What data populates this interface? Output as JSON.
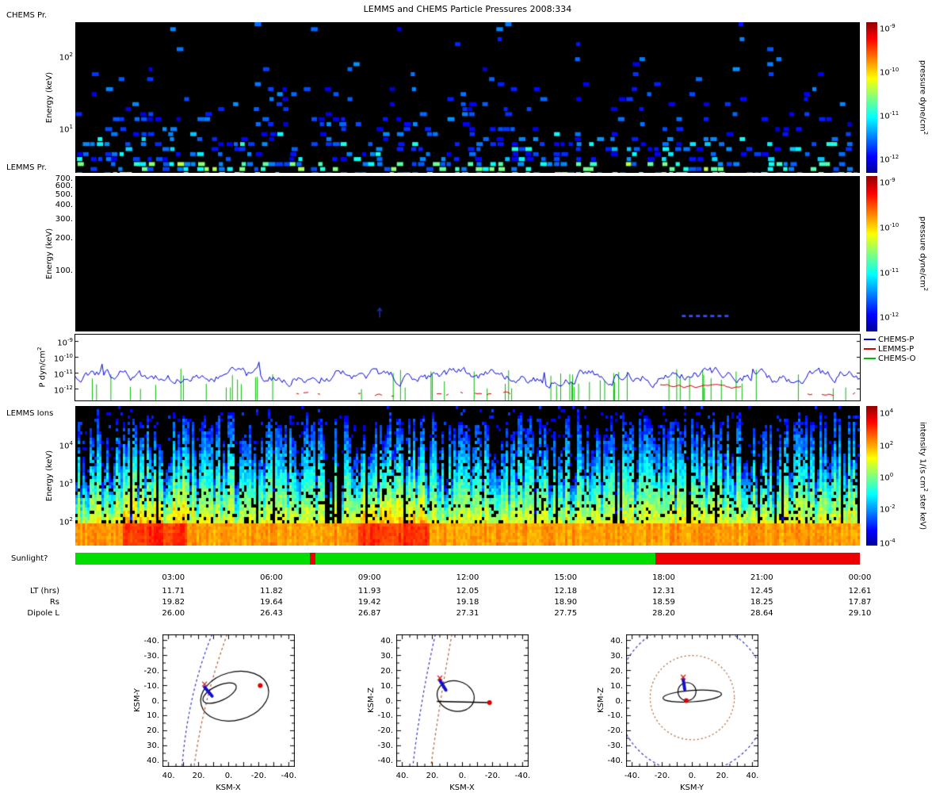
{
  "title": "LEMMS and CHEMS Particle Pressures  2008:334",
  "panel_chems": {
    "label": "CHEMS Pr.",
    "ylabel": "Energy (keV)",
    "yticks": [
      {
        "t": "10^2",
        "f": 0.22
      },
      {
        "t": "10^1",
        "f": 0.7
      }
    ],
    "colorbar": {
      "label": "pressure dyne/cm^2",
      "ticks": [
        {
          "t": "10^-9",
          "f": 0.03
        },
        {
          "t": "10^-10",
          "f": 0.32
        },
        {
          "t": "10^-11",
          "f": 0.61
        },
        {
          "t": "10^-12",
          "f": 0.9
        }
      ]
    }
  },
  "panel_lemms": {
    "label": "LEMMS Pr.",
    "ylabel": "Energy (keV)",
    "yticks": [
      {
        "t": "700.",
        "f": 0.021
      },
      {
        "t": "600.",
        "f": 0.068
      },
      {
        "t": "500.",
        "f": 0.123
      },
      {
        "t": "400.",
        "f": 0.191
      },
      {
        "t": "300.",
        "f": 0.279
      },
      {
        "t": "200.",
        "f": 0.402
      },
      {
        "t": "100.",
        "f": 0.613
      }
    ],
    "features": {
      "dash": {
        "x0": 0.773,
        "x1": 0.833,
        "yf": 0.9
      },
      "arrow": {
        "x": 0.388,
        "yf": 0.85
      }
    },
    "colorbar": {
      "label": "pressure dyne/cm^2",
      "ticks": [
        {
          "t": "10^-9",
          "f": 0.03
        },
        {
          "t": "10^-10",
          "f": 0.32
        },
        {
          "t": "10^-11",
          "f": 0.61
        },
        {
          "t": "10^-12",
          "f": 0.9
        }
      ]
    }
  },
  "panel_pressure": {
    "ylabel": "P dyn/cm^2",
    "yticks": [
      {
        "t": "10^-9",
        "f": 0.1
      },
      {
        "t": "10^-10",
        "f": 0.34
      },
      {
        "t": "10^-11",
        "f": 0.58
      },
      {
        "t": "10^-12",
        "f": 0.82
      }
    ],
    "legend": [
      {
        "label": "CHEMS-P",
        "color": "#0000dd"
      },
      {
        "label": "LEMMS-P",
        "color": "#dd0000"
      },
      {
        "label": "CHEMS-O",
        "color": "#00bb00"
      }
    ]
  },
  "panel_ions": {
    "label": "LEMMS Ions",
    "ylabel": "Energy (keV)",
    "yticks": [
      {
        "t": "10^4",
        "f": 0.27
      },
      {
        "t": "10^3",
        "f": 0.545
      },
      {
        "t": "10^2",
        "f": 0.82
      }
    ],
    "orange_zones": [
      [
        0.06,
        0.14
      ],
      [
        0.36,
        0.45
      ]
    ],
    "colorbar": {
      "label": "intensity 1/(s cm^2 ster keV)",
      "ticks": [
        {
          "t": "10^4",
          "f": 0.04
        },
        {
          "t": "10^2",
          "f": 0.27
        },
        {
          "t": "10^0",
          "f": 0.5
        },
        {
          "t": "10^-2",
          "f": 0.73
        },
        {
          "t": "10^-4",
          "f": 0.97
        }
      ]
    }
  },
  "sunlight": {
    "label": "Sunlight?",
    "segments": [
      {
        "color": "#00dd00",
        "f0": 0.0,
        "f1": 0.739
      },
      {
        "color": "#ee0000",
        "f0": 0.299,
        "f1": 0.306
      },
      {
        "color": "#ee0000",
        "f0": 0.739,
        "f1": 1.0
      }
    ]
  },
  "time_axis": {
    "ticks": [
      "03:00",
      "06:00",
      "09:00",
      "12:00",
      "15:00",
      "18:00",
      "21:00",
      "00:00"
    ],
    "rows": [
      {
        "label": "LT (hrs)",
        "values": [
          "11.71",
          "11.82",
          "11.93",
          "12.05",
          "12.18",
          "12.31",
          "12.45",
          "12.61"
        ]
      },
      {
        "label": "Rs",
        "values": [
          "19.82",
          "19.64",
          "19.42",
          "19.18",
          "18.90",
          "18.59",
          "18.25",
          "17.87"
        ]
      },
      {
        "label": "Dipole L",
        "values": [
          "26.00",
          "26.43",
          "26.87",
          "27.31",
          "27.75",
          "28.20",
          "28.64",
          "29.10"
        ]
      }
    ]
  },
  "orbit_plots": [
    {
      "xlabel": "KSM-X",
      "ylabel": "KSM-Y",
      "xlim": [
        44,
        -44
      ],
      "ylim": [
        -44,
        44
      ],
      "xtick_labels": [
        "40.",
        "20.",
        "0.",
        "-20.",
        "-40."
      ],
      "ytick_labels": [
        "-40.",
        "-30.",
        "-20.",
        "-10.",
        "0.",
        "10.",
        "20.",
        "30.",
        "40."
      ],
      "curves": [
        {
          "color": "#3333cc",
          "p0": [
            11,
            -44
          ],
          "c": [
            27,
            -5
          ],
          "p1": [
            31,
            44
          ]
        },
        {
          "color": "#b06030",
          "p0": [
            1,
            -44
          ],
          "c": [
            17,
            0
          ],
          "p1": [
            23,
            44
          ]
        }
      ],
      "ellipses": [
        {
          "cx": -4,
          "cy": -3,
          "rx": 23,
          "ry": 16,
          "rot": -15
        },
        {
          "cx": 6,
          "cy": -5,
          "rx": 12,
          "ry": 5,
          "rot": -25
        }
      ],
      "segments": [
        {
          "p0": [
            16,
            -9
          ],
          "p1": [
            11,
            -3
          ],
          "color": "#1111cc",
          "w": 4
        }
      ],
      "markers": [
        {
          "type": "dot",
          "x": -21,
          "y": -10,
          "color": "#dd0000"
        },
        {
          "type": "cross",
          "x": 16,
          "y": -11,
          "color": "#dd2222"
        }
      ]
    },
    {
      "xlabel": "KSM-X",
      "ylabel": "KSM-Z",
      "xlim": [
        44,
        -44
      ],
      "ylim": [
        44,
        -44
      ],
      "xtick_labels": [
        "40.",
        "20.",
        "0.",
        "-20.",
        "-40."
      ],
      "ytick_labels": [
        "40.",
        "30.",
        "20.",
        "10.",
        "0.",
        "-10.",
        "-20.",
        "-30.",
        "-40."
      ],
      "curves": [
        {
          "color": "#3333cc",
          "p0": [
            18,
            44
          ],
          "c": [
            28,
            0
          ],
          "p1": [
            33,
            -44
          ]
        },
        {
          "color": "#b06030",
          "p0": [
            7,
            44
          ],
          "c": [
            15,
            0
          ],
          "p1": [
            21,
            -44
          ]
        }
      ],
      "ellipses": [
        {
          "cx": 4.5,
          "cy": 3,
          "rx": 12.5,
          "ry": 10,
          "rot": 15
        }
      ],
      "lines": [
        {
          "p0": [
            17,
            -0.5
          ],
          "p1": [
            -18,
            -1.3
          ],
          "color": "#000000",
          "w": 1.6
        }
      ],
      "segments": [
        {
          "p0": [
            15,
            13.5
          ],
          "p1": [
            11,
            7
          ],
          "color": "#1111cc",
          "w": 4
        }
      ],
      "markers": [
        {
          "type": "dot",
          "x": -18,
          "y": -1.3,
          "color": "#dd0000"
        },
        {
          "type": "cross",
          "x": 15,
          "y": 15,
          "color": "#dd2222"
        }
      ]
    },
    {
      "xlabel": "KSM-Y",
      "ylabel": "KSM-Z",
      "xlim": [
        -44,
        44
      ],
      "ylim": [
        44,
        -44
      ],
      "xtick_labels": [
        "-40.",
        "-20.",
        "0.",
        "20.",
        "40."
      ],
      "ytick_labels": [
        "40.",
        "30.",
        "20.",
        "10.",
        "0.",
        "-10.",
        "-20.",
        "-30.",
        "-40."
      ],
      "circles": [
        {
          "cx": 0,
          "cy": 2,
          "r": 28,
          "color": "#b06030",
          "dash": [
            2,
            3
          ]
        },
        {
          "cx": 0,
          "cy": 2,
          "r": 50,
          "color": "#3333cc",
          "dash": [
            3,
            3
          ]
        }
      ],
      "ellipses": [
        {
          "cx": 0,
          "cy": 3,
          "rx": 19.5,
          "ry": 3.8,
          "rot": -4
        },
        {
          "cx": -3.5,
          "cy": 6,
          "rx": 6,
          "ry": 6,
          "rot": 0
        }
      ],
      "segments": [
        {
          "p0": [
            -6,
            14
          ],
          "p1": [
            -5,
            7.5
          ],
          "color": "#1111cc",
          "w": 4
        }
      ],
      "markers": [
        {
          "type": "dot",
          "x": -4,
          "y": 0,
          "color": "#dd0000"
        },
        {
          "type": "cross",
          "x": -6,
          "y": 15.5,
          "color": "#dd2222"
        }
      ]
    }
  ],
  "chart_data": [
    {
      "type": "heatmap",
      "title": "CHEMS Pr.",
      "ylabel": "Energy (keV)",
      "yscale": "log",
      "ylim": [
        3,
        250
      ],
      "x_span_hours": [
        0,
        24
      ],
      "zlabel": "pressure dyne/cm^2",
      "zscale": "log",
      "zlim": [
        1e-12,
        1e-09
      ],
      "colormap": "jet",
      "background": "black",
      "pattern": "sparse scattered cells, mostly blue 1e-12..1e-11; density and cyan/green values (~1e-11..3e-11) increase toward the lowest energies"
    },
    {
      "type": "heatmap",
      "title": "LEMMS Pr.",
      "ylabel": "Energy (keV)",
      "yscale": "log",
      "ylim": [
        28,
        750
      ],
      "yticks": [
        100,
        200,
        300,
        400,
        500,
        600,
        700
      ],
      "zlabel": "pressure dyne/cm^2",
      "zscale": "log",
      "zlim": [
        1e-12,
        1e-09
      ],
      "colormap": "jet",
      "background": "black",
      "pattern": "nearly empty; faint blue dashed horizontal segment ~18:30-20:00 near 40 keV; single faint blue mark ~09:20 near 45 keV"
    },
    {
      "type": "line",
      "ylabel": "P dyn/cm^2",
      "yscale": "log",
      "ylim": [
        2e-13,
        2e-09
      ],
      "series": [
        {
          "name": "CHEMS-P",
          "color": "#0000dd",
          "typical_level": 5e-12,
          "range": [
            8e-13,
            4e-11
          ],
          "coverage": "continuous 00:00-24:00"
        },
        {
          "name": "LEMMS-P",
          "color": "#dd0000",
          "typical_level": 2e-13,
          "visible_intervals_hours": [
            [
              6.7,
              14
            ],
            [
              17.9,
              20.4
            ],
            [
              22.3,
              24
            ]
          ],
          "level_in_intervals": 1e-12
        },
        {
          "name": "CHEMS-O",
          "color": "#00bb00",
          "description": "sparse narrow spikes rising from below 1e-12 up to ~1e-11"
        }
      ],
      "legend_position": "right outside"
    },
    {
      "type": "heatmap",
      "title": "LEMMS Ions",
      "ylabel": "Energy (keV)",
      "yscale": "log",
      "ylim": [
        20,
        100000
      ],
      "zlabel": "intensity 1/(s cm^2 ster keV)",
      "zscale": "log",
      "zlim": [
        1e-05,
        10000.0
      ],
      "colormap": "jet",
      "background": "black",
      "pattern": "dense vertical striping across full width; solid yellow-orange band at lowest energies (intensity 10..1000), green-cyan mid energies, sparse blue columns reaching highest energies, intermittent black gaps"
    },
    {
      "type": "bar",
      "title": "Sunlight?",
      "segments": [
        {
          "from_hours": 0,
          "to_hours": 17.73,
          "state": "sunlit",
          "color": "#00dd00"
        },
        {
          "from_hours": 7.17,
          "to_hours": 7.35,
          "state": "shadow",
          "color": "#ee0000"
        },
        {
          "from_hours": 17.73,
          "to_hours": 24,
          "state": "shadow",
          "color": "#ee0000"
        }
      ]
    },
    {
      "type": "scatter",
      "title": "trajectory projections (Rs)",
      "subplots": [
        {
          "xlabel": "KSM-X",
          "ylabel": "KSM-Y",
          "xlim": [
            40,
            -40
          ],
          "ylim": [
            -40,
            40
          ],
          "elements": [
            "black orbit ellipses",
            "blue dashed bow shock",
            "brown dashed magnetopause",
            "blue spacecraft segment (16,-9)->(11,-3)",
            "red dot (-21,-10)"
          ]
        },
        {
          "xlabel": "KSM-X",
          "ylabel": "KSM-Z",
          "xlim": [
            40,
            -40
          ],
          "ylim": [
            40,
            -40
          ],
          "elements": [
            "black orbit ellipse with edge-on line",
            "blue dashed bow shock",
            "brown dashed magnetopause",
            "blue spacecraft segment (15,14)->(11,7)",
            "red dot (-18,-1)"
          ]
        },
        {
          "xlabel": "KSM-Y",
          "ylabel": "KSM-Z",
          "xlim": [
            -40,
            40
          ],
          "ylim": [
            40,
            -40
          ],
          "elements": [
            "black orbit ellipses",
            "blue dashed circle r~50",
            "brown dashed circle r~28",
            "blue spacecraft segment (-6,14)->(-5,8)",
            "red dot (-4,0)"
          ]
        }
      ]
    }
  ]
}
